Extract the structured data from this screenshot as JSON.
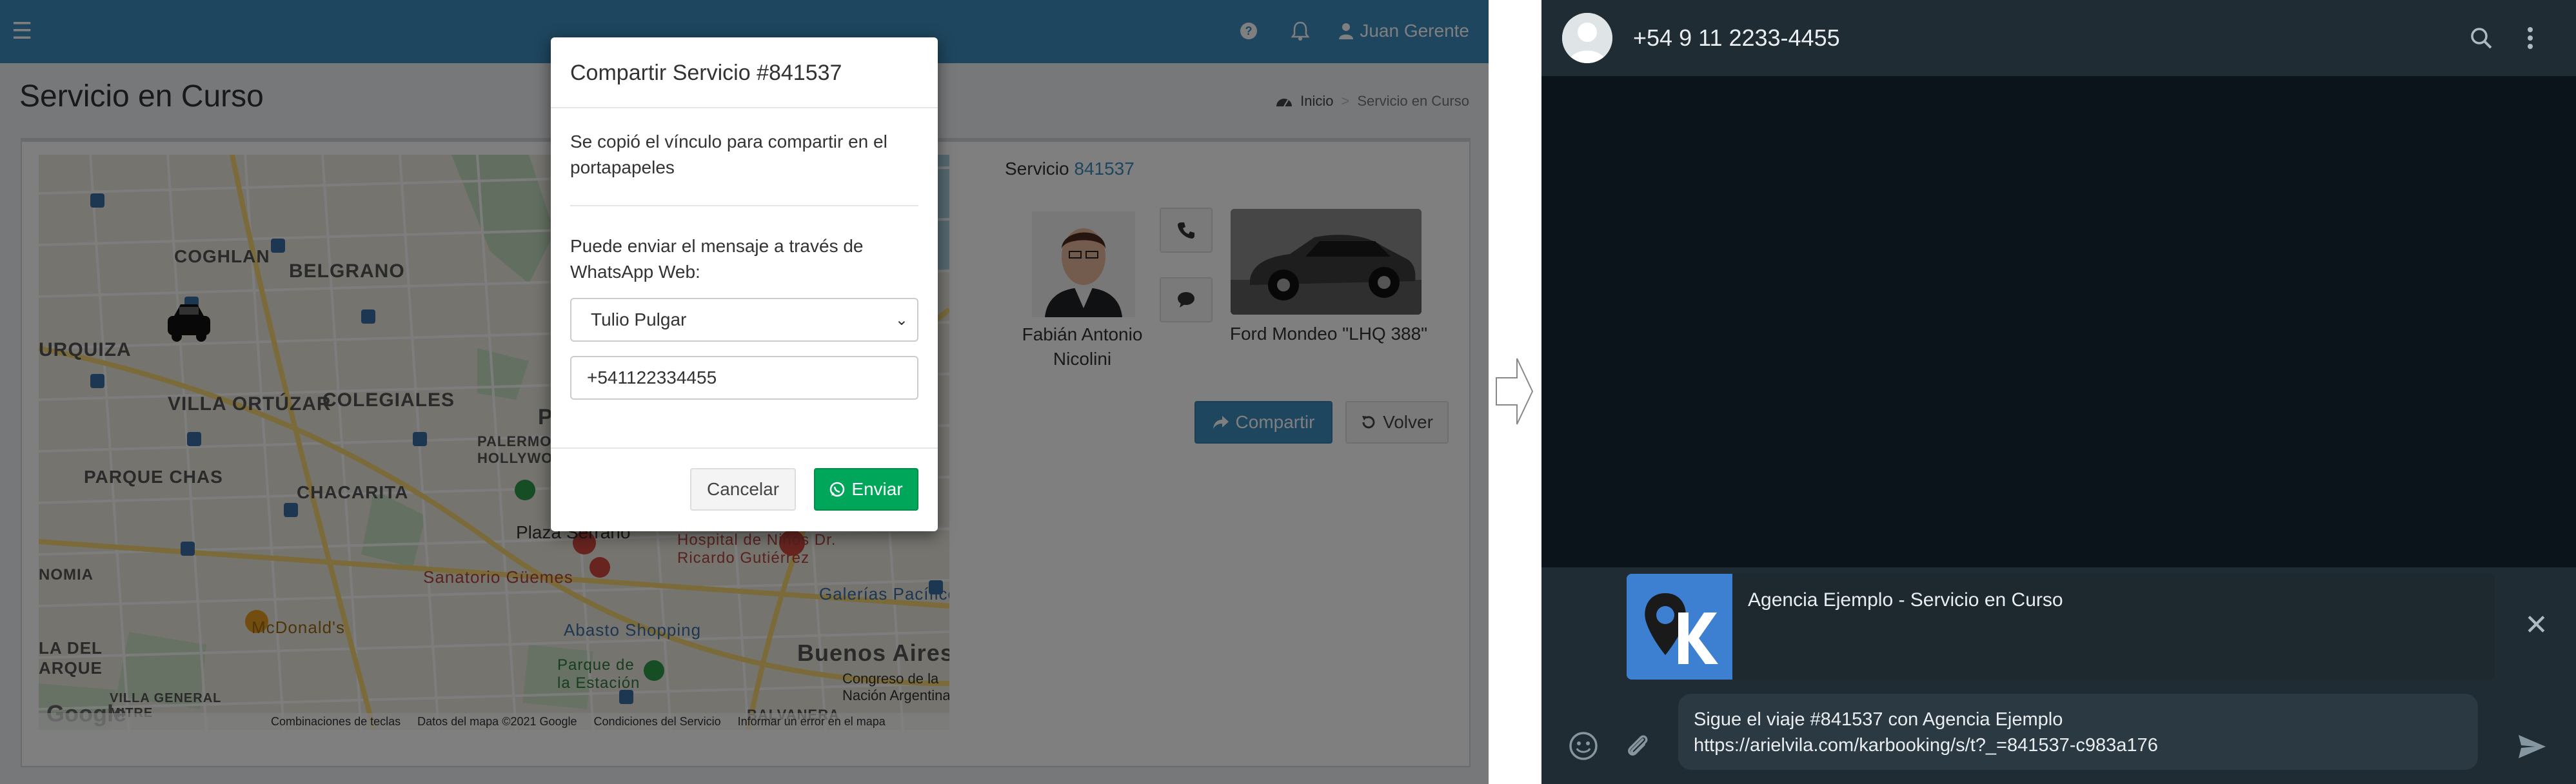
{
  "admin": {
    "user_name": "Juan Gerente",
    "page_title": "Servicio en Curso",
    "breadcrumb": {
      "home": "Inicio",
      "current": "Servicio en Curso"
    },
    "service": {
      "label": "Servicio",
      "number": "841537"
    },
    "driver_name": "Fabián Antonio Nicolini",
    "car_name": "Ford Mondeo \"LHQ 388\"",
    "share_button": "Compartir",
    "back_button": "Volver",
    "map": {
      "labels": [
        "COGHLAN",
        "BELGRANO",
        "URQUIZA",
        "VILLA ORTÚZAR",
        "COLEGIALES",
        "PALERMO HOLLYWOOD",
        "PARQUE CHAS",
        "CHACARITA",
        "Plaza Serrano",
        "Sanatorio Güemes",
        "McDonald's",
        "Abasto Shopping",
        "Parque de la Estación",
        "Hospital de Niños Dr. Ricardo Gutiérrez",
        "Galerías Pacífico",
        "Buenos Aires",
        "Congreso de la Nación Argentina",
        "VILLA GENERAL MITRE",
        "BALVANERA",
        "NOMIA",
        "LA DEL ARQUE",
        "PALE"
      ],
      "footer": [
        "Combinaciones de teclas",
        "Datos del mapa ©2021 Google",
        "Condiciones del Servicio",
        "Informar un error en el mapa"
      ],
      "logo": "Google"
    }
  },
  "modal": {
    "title": "Compartir Servicio #841537",
    "copied_text": "Se copió el vínculo para compartir en el portapapeles",
    "send_text": "Puede enviar el mensaje a través de WhatsApp Web:",
    "contact_selected": "Tulio Pulgar",
    "phone_value": "+541122334455",
    "cancel_button": "Cancelar",
    "send_button": "Enviar"
  },
  "whatsapp": {
    "contact_phone": "+54 9 11 2233-4455",
    "preview_title": "Agencia Ejemplo - Servicio en Curso",
    "message_line1": "Sigue el viaje #841537 con Agencia Ejemplo",
    "message_line2": "https://arielvila.com/karbooking/s/t?_=841537-c983a176"
  },
  "colors": {
    "admin_header": "#3c8dbc",
    "primary": "#3c8dbc",
    "success": "#00a65a",
    "wa_dark": "#111b21",
    "wa_panel": "#202c33"
  }
}
